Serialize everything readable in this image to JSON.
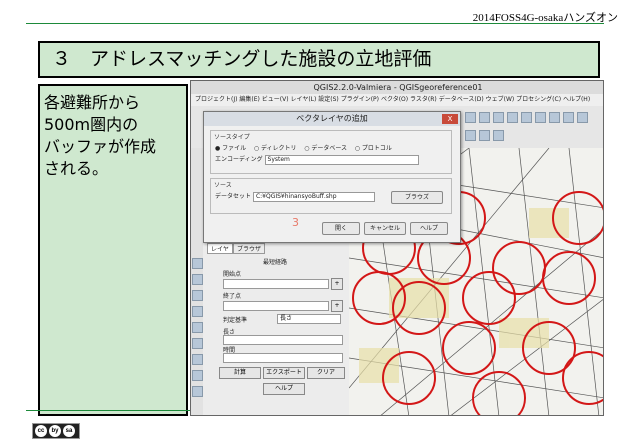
{
  "header": {
    "event": "2014FOSS4G-osakaハンズオン"
  },
  "slide": {
    "title": "３　アドレスマッチングした施設の立地評価",
    "side_lines": [
      "各避難所から",
      "500m圏内の",
      "バッファが作成",
      "される。"
    ]
  },
  "license": {
    "icons": [
      "cc",
      "by",
      "sa"
    ]
  },
  "qgis": {
    "window_title": "QGIS2.2.0-Valmiera - QGISgeoreference01",
    "menu": [
      "プロジェクト(J)",
      "編集(E)",
      "ビュー(V)",
      "レイヤ(L)",
      "設定(S)",
      "プラグイン(P)",
      "ベクタ(O)",
      "ラスタ(R)",
      "データベース(D)",
      "ウェブ(W)",
      "プロセシング(C)",
      "ヘルプ(H)"
    ],
    "dialog": {
      "title": "ベクタレイヤの追加",
      "close": "X",
      "source_type_label": "ソースタイプ",
      "options": [
        "ファイル",
        "ディレクトリ",
        "データベース",
        "プロトコル"
      ],
      "encoding_label": "エンコーディング",
      "encoding_value": "System",
      "source_label": "ソース",
      "dataset_label": "データセット",
      "dataset_value": "C:¥QGIS¥hinansyoBuff.shp",
      "browse": "ブラウズ",
      "open": "開く",
      "cancel": "キャンセル",
      "help": "ヘルプ",
      "step": "3"
    },
    "panel": {
      "tabs": [
        "レイヤ",
        "ブラウザ"
      ],
      "heading": "最短経路",
      "start": "開始点",
      "end": "終了点",
      "criterion_label": "判定基準",
      "criterion_value": "長さ",
      "length": "長さ",
      "time": "時間",
      "calc": "計算",
      "export": "エクスポート",
      "clear": "クリア",
      "help": "ヘルプ"
    }
  }
}
